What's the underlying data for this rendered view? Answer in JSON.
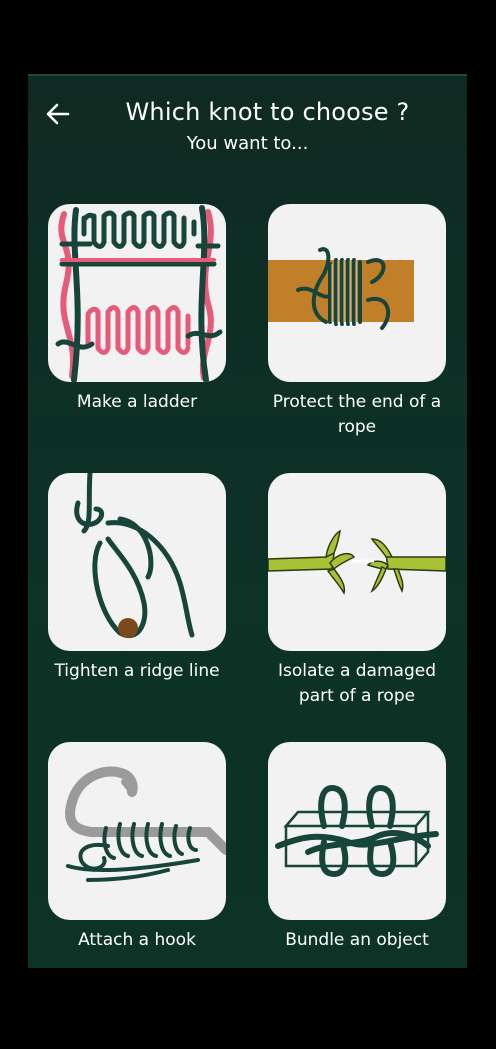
{
  "header": {
    "title": "Which knot to choose ?",
    "subtitle": "You want to..."
  },
  "icons": {
    "back": "arrow-left-icon"
  },
  "colors": {
    "background": "#0d3126",
    "card": "#f2f2f3",
    "rope_dark": "#17453a",
    "rope_pink": "#e75a78",
    "wood": "#c07f28",
    "rope_green": "#a7c234",
    "hook_gray": "#9b9b9b"
  },
  "options": [
    {
      "label": "Make a ladder",
      "icon": "ladder-knot-icon"
    },
    {
      "label": "Protect the end of a rope",
      "icon": "whipping-knot-icon"
    },
    {
      "label": "Tighten a ridge line",
      "icon": "ridge-line-knot-icon"
    },
    {
      "label": "Isolate a damaged part of a rope",
      "icon": "damaged-rope-knot-icon"
    },
    {
      "label": "Attach a hook",
      "icon": "hook-knot-icon"
    },
    {
      "label": "Bundle an object",
      "icon": "bundle-knot-icon"
    }
  ]
}
